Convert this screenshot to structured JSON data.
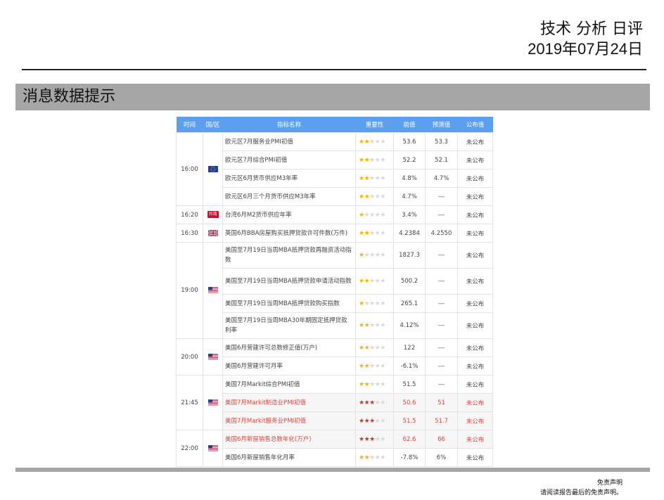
{
  "header": {
    "title": "技术 分析 日评",
    "date": "2019年07月24日"
  },
  "section": {
    "title": "消息数据提示"
  },
  "table": {
    "columns": [
      "时间",
      "国/区",
      "指标名称",
      "重要性",
      "前值",
      "预测值",
      "公布值"
    ],
    "groups": [
      {
        "time": "16:00",
        "region": "eu-flag-icon",
        "rows": [
          {
            "name": "欧元区7月服务业PMI初值",
            "stars": 2,
            "prev": "53.6",
            "forecast": "53.3",
            "published": "未公布",
            "highlight": false
          },
          {
            "name": "欧元区7月综合PMI初值",
            "stars": 2,
            "prev": "52.2",
            "forecast": "52.1",
            "published": "未公布",
            "highlight": false
          },
          {
            "name": "欧元区6月货币供应M3年率",
            "stars": 2,
            "prev": "4.8%",
            "forecast": "4.7%",
            "published": "未公布",
            "highlight": false
          },
          {
            "name": "欧元区6月三个月货币供应M3年率",
            "stars": 2,
            "prev": "4.7%",
            "forecast": "---",
            "published": "未公布",
            "highlight": false
          }
        ]
      },
      {
        "time": "16:20",
        "region": "taiwan-badge-icon",
        "region_text": "台湾",
        "rows": [
          {
            "name": "台湾6月M2货币供应年率",
            "stars": 1,
            "prev": "3.4%",
            "forecast": "---",
            "published": "未公布",
            "highlight": false
          }
        ]
      },
      {
        "time": "16:30",
        "region": "uk-flag-icon",
        "rows": [
          {
            "name": "英国6月BBA房屋购买抵押贷款许可件数(万件)",
            "stars": 2,
            "prev": "4.2384",
            "forecast": "4.2550",
            "published": "未公布",
            "highlight": false
          }
        ]
      },
      {
        "time": "19:00",
        "region": "us-flag-icon",
        "rows": [
          {
            "name": "美国至7月19日当周MBA抵押贷款再融资活动指数",
            "stars": 1,
            "prev": "1827.3",
            "forecast": "---",
            "published": "未公布",
            "highlight": false
          },
          {
            "name": "美国至7月19日当周MBA抵押贷款申请活动指数",
            "stars": 2,
            "prev": "500.2",
            "forecast": "---",
            "published": "未公布",
            "highlight": false
          },
          {
            "name": "美国至7月19日当周MBA抵押贷款购买指数",
            "stars": 1,
            "prev": "265.1",
            "forecast": "---",
            "published": "未公布",
            "highlight": false
          },
          {
            "name": "美国至7月19日当周MBA30年期固定抵押贷款利率",
            "stars": 2,
            "prev": "4.12%",
            "forecast": "---",
            "published": "未公布",
            "highlight": false
          }
        ]
      },
      {
        "time": "20:00",
        "region": "us-flag-icon",
        "rows": [
          {
            "name": "美国6月营建许可总数修正值(万户)",
            "stars": 2,
            "prev": "122",
            "forecast": "---",
            "published": "未公布",
            "highlight": false
          },
          {
            "name": "美国6月营建许可月率",
            "stars": 2,
            "prev": "-6.1%",
            "forecast": "---",
            "published": "未公布",
            "highlight": false
          }
        ]
      },
      {
        "time": "21:45",
        "region": "us-flag-icon",
        "rows": [
          {
            "name": "美国7月Markit综合PMI初值",
            "stars": 2,
            "prev": "51.5",
            "forecast": "---",
            "published": "未公布",
            "highlight": false
          },
          {
            "name": "美国7月Markit制造业PMI初值",
            "stars": 3,
            "prev": "50.6",
            "forecast": "51",
            "published": "未公布",
            "highlight": true
          },
          {
            "name": "美国7月Markit服务业PMI初值",
            "stars": 3,
            "prev": "51.5",
            "forecast": "51.7",
            "published": "未公布",
            "highlight": true
          }
        ]
      },
      {
        "time": "22:00",
        "region": "us-flag-icon",
        "rows": [
          {
            "name": "美国6月新屋销售总数年化(万户)",
            "stars": 3,
            "prev": "62.6",
            "forecast": "66",
            "published": "未公布",
            "highlight": true
          },
          {
            "name": "美国6月新屋销售年化月率",
            "stars": 2,
            "prev": "-7.8%",
            "forecast": "6%",
            "published": "未公布",
            "highlight": false
          }
        ]
      }
    ],
    "max_stars": 5,
    "colors": {
      "header_bg": "#5b9ff0",
      "star_on": "#f5b400",
      "star_on_high": "#d9302a",
      "star_off": "#d8d8d8",
      "highlight_text": "#e0443c"
    }
  },
  "footer": {
    "disclaimer_title": "免责声明",
    "disclaimer_text": "请阅读报告最后的免责声明。"
  }
}
